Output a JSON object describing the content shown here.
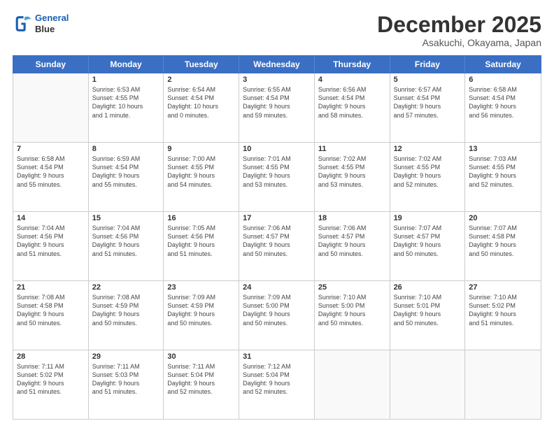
{
  "header": {
    "logo_line1": "General",
    "logo_line2": "Blue",
    "title": "December 2025",
    "subtitle": "Asakuchi, Okayama, Japan"
  },
  "weekdays": [
    "Sunday",
    "Monday",
    "Tuesday",
    "Wednesday",
    "Thursday",
    "Friday",
    "Saturday"
  ],
  "weeks": [
    [
      {
        "day": "",
        "info": ""
      },
      {
        "day": "1",
        "info": "Sunrise: 6:53 AM\nSunset: 4:55 PM\nDaylight: 10 hours\nand 1 minute."
      },
      {
        "day": "2",
        "info": "Sunrise: 6:54 AM\nSunset: 4:54 PM\nDaylight: 10 hours\nand 0 minutes."
      },
      {
        "day": "3",
        "info": "Sunrise: 6:55 AM\nSunset: 4:54 PM\nDaylight: 9 hours\nand 59 minutes."
      },
      {
        "day": "4",
        "info": "Sunrise: 6:56 AM\nSunset: 4:54 PM\nDaylight: 9 hours\nand 58 minutes."
      },
      {
        "day": "5",
        "info": "Sunrise: 6:57 AM\nSunset: 4:54 PM\nDaylight: 9 hours\nand 57 minutes."
      },
      {
        "day": "6",
        "info": "Sunrise: 6:58 AM\nSunset: 4:54 PM\nDaylight: 9 hours\nand 56 minutes."
      }
    ],
    [
      {
        "day": "7",
        "info": "Sunrise: 6:58 AM\nSunset: 4:54 PM\nDaylight: 9 hours\nand 55 minutes."
      },
      {
        "day": "8",
        "info": "Sunrise: 6:59 AM\nSunset: 4:54 PM\nDaylight: 9 hours\nand 55 minutes."
      },
      {
        "day": "9",
        "info": "Sunrise: 7:00 AM\nSunset: 4:55 PM\nDaylight: 9 hours\nand 54 minutes."
      },
      {
        "day": "10",
        "info": "Sunrise: 7:01 AM\nSunset: 4:55 PM\nDaylight: 9 hours\nand 53 minutes."
      },
      {
        "day": "11",
        "info": "Sunrise: 7:02 AM\nSunset: 4:55 PM\nDaylight: 9 hours\nand 53 minutes."
      },
      {
        "day": "12",
        "info": "Sunrise: 7:02 AM\nSunset: 4:55 PM\nDaylight: 9 hours\nand 52 minutes."
      },
      {
        "day": "13",
        "info": "Sunrise: 7:03 AM\nSunset: 4:55 PM\nDaylight: 9 hours\nand 52 minutes."
      }
    ],
    [
      {
        "day": "14",
        "info": "Sunrise: 7:04 AM\nSunset: 4:56 PM\nDaylight: 9 hours\nand 51 minutes."
      },
      {
        "day": "15",
        "info": "Sunrise: 7:04 AM\nSunset: 4:56 PM\nDaylight: 9 hours\nand 51 minutes."
      },
      {
        "day": "16",
        "info": "Sunrise: 7:05 AM\nSunset: 4:56 PM\nDaylight: 9 hours\nand 51 minutes."
      },
      {
        "day": "17",
        "info": "Sunrise: 7:06 AM\nSunset: 4:57 PM\nDaylight: 9 hours\nand 50 minutes."
      },
      {
        "day": "18",
        "info": "Sunrise: 7:06 AM\nSunset: 4:57 PM\nDaylight: 9 hours\nand 50 minutes."
      },
      {
        "day": "19",
        "info": "Sunrise: 7:07 AM\nSunset: 4:57 PM\nDaylight: 9 hours\nand 50 minutes."
      },
      {
        "day": "20",
        "info": "Sunrise: 7:07 AM\nSunset: 4:58 PM\nDaylight: 9 hours\nand 50 minutes."
      }
    ],
    [
      {
        "day": "21",
        "info": "Sunrise: 7:08 AM\nSunset: 4:58 PM\nDaylight: 9 hours\nand 50 minutes."
      },
      {
        "day": "22",
        "info": "Sunrise: 7:08 AM\nSunset: 4:59 PM\nDaylight: 9 hours\nand 50 minutes."
      },
      {
        "day": "23",
        "info": "Sunrise: 7:09 AM\nSunset: 4:59 PM\nDaylight: 9 hours\nand 50 minutes."
      },
      {
        "day": "24",
        "info": "Sunrise: 7:09 AM\nSunset: 5:00 PM\nDaylight: 9 hours\nand 50 minutes."
      },
      {
        "day": "25",
        "info": "Sunrise: 7:10 AM\nSunset: 5:00 PM\nDaylight: 9 hours\nand 50 minutes."
      },
      {
        "day": "26",
        "info": "Sunrise: 7:10 AM\nSunset: 5:01 PM\nDaylight: 9 hours\nand 50 minutes."
      },
      {
        "day": "27",
        "info": "Sunrise: 7:10 AM\nSunset: 5:02 PM\nDaylight: 9 hours\nand 51 minutes."
      }
    ],
    [
      {
        "day": "28",
        "info": "Sunrise: 7:11 AM\nSunset: 5:02 PM\nDaylight: 9 hours\nand 51 minutes."
      },
      {
        "day": "29",
        "info": "Sunrise: 7:11 AM\nSunset: 5:03 PM\nDaylight: 9 hours\nand 51 minutes."
      },
      {
        "day": "30",
        "info": "Sunrise: 7:11 AM\nSunset: 5:04 PM\nDaylight: 9 hours\nand 52 minutes."
      },
      {
        "day": "31",
        "info": "Sunrise: 7:12 AM\nSunset: 5:04 PM\nDaylight: 9 hours\nand 52 minutes."
      },
      {
        "day": "",
        "info": ""
      },
      {
        "day": "",
        "info": ""
      },
      {
        "day": "",
        "info": ""
      }
    ]
  ]
}
